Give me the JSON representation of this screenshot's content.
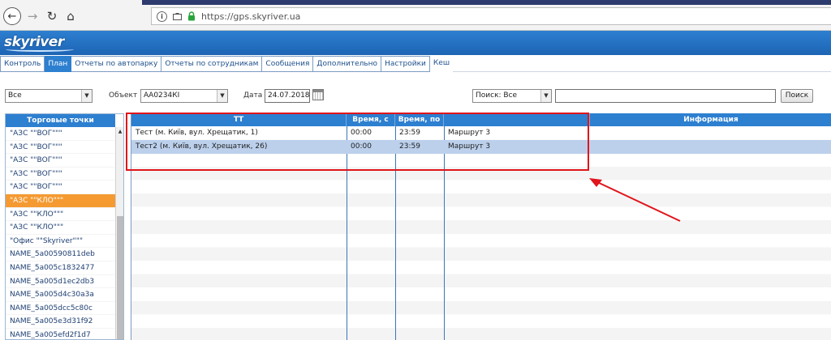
{
  "browser": {
    "back": "←",
    "forward": "→",
    "reload": "↻",
    "home": "⌂",
    "url": "https://gps.skyriver.ua",
    "icons": [
      "info-icon",
      "camera-icon",
      "lock-icon"
    ]
  },
  "logo": {
    "text": "skyriver"
  },
  "menu": [
    {
      "label": "Контроль",
      "active": false
    },
    {
      "label": "План",
      "active": true
    },
    {
      "label": "Отчеты по автопарку",
      "active": false
    },
    {
      "label": "Отчеты по сотрудникам",
      "active": false
    },
    {
      "label": "Сообщения",
      "active": false
    },
    {
      "label": "Дополнительно",
      "active": false
    },
    {
      "label": "Настройки",
      "active": false
    },
    {
      "label": "Кеш",
      "active": false
    }
  ],
  "filters": {
    "type_value": "Все",
    "object_label": "Объект",
    "object_value": "АА0234КІ",
    "date_label": "Дата",
    "date_value": "24.07.2018",
    "search_select_value": "Поиск: Все",
    "search_text": "",
    "search_button": "Поиск"
  },
  "left_panel": {
    "header": "Торговые точки",
    "items": [
      "\"АЗС \"\"ВОГ\"\"\"",
      "\"АЗС \"\"ВОГ\"\"\"",
      "\"АЗС \"\"ВОГ\"\"\"",
      "\"АЗС \"\"ВОГ\"\"\"",
      "\"АЗС \"\"ВОГ\"\"\"",
      "\"АЗС \"\"КЛО\"\"\"",
      "\"АЗС \"\"КЛО\"\"\"",
      "\"АЗС \"\"КЛО\"\"\"",
      "\"Офис \"\"Skyriver\"\"\"",
      "NAME_5a00590811deb",
      "NAME_5a005c1832477",
      "NAME_5a005d1ec2db3",
      "NAME_5a005d4c30a3a",
      "NAME_5a005dcc5c80c",
      "NAME_5a005e3d31f92",
      "NAME_5a005efd2f1d7"
    ],
    "selected_index": 5
  },
  "grid": {
    "columns": [
      "ТТ",
      "Время, с",
      "Время, по",
      "",
      "Информация"
    ],
    "rows": [
      {
        "tt": "Тест (м. Київ, вул. Хрещатик, 1)",
        "from": "00:00",
        "to": "23:59",
        "route": "Маршрут 3",
        "info": ""
      },
      {
        "tt": "Тест2 (м. Київ, вул. Хрещатик, 26)",
        "from": "00:00",
        "to": "23:59",
        "route": "Маршрут 3",
        "info": ""
      }
    ],
    "selected_row": 1
  },
  "colors": {
    "header_blue": "#2d7fd0",
    "selected_orange": "#f59a31",
    "selected_row": "#bcd0ec",
    "annotation_red": "#e0151b"
  }
}
